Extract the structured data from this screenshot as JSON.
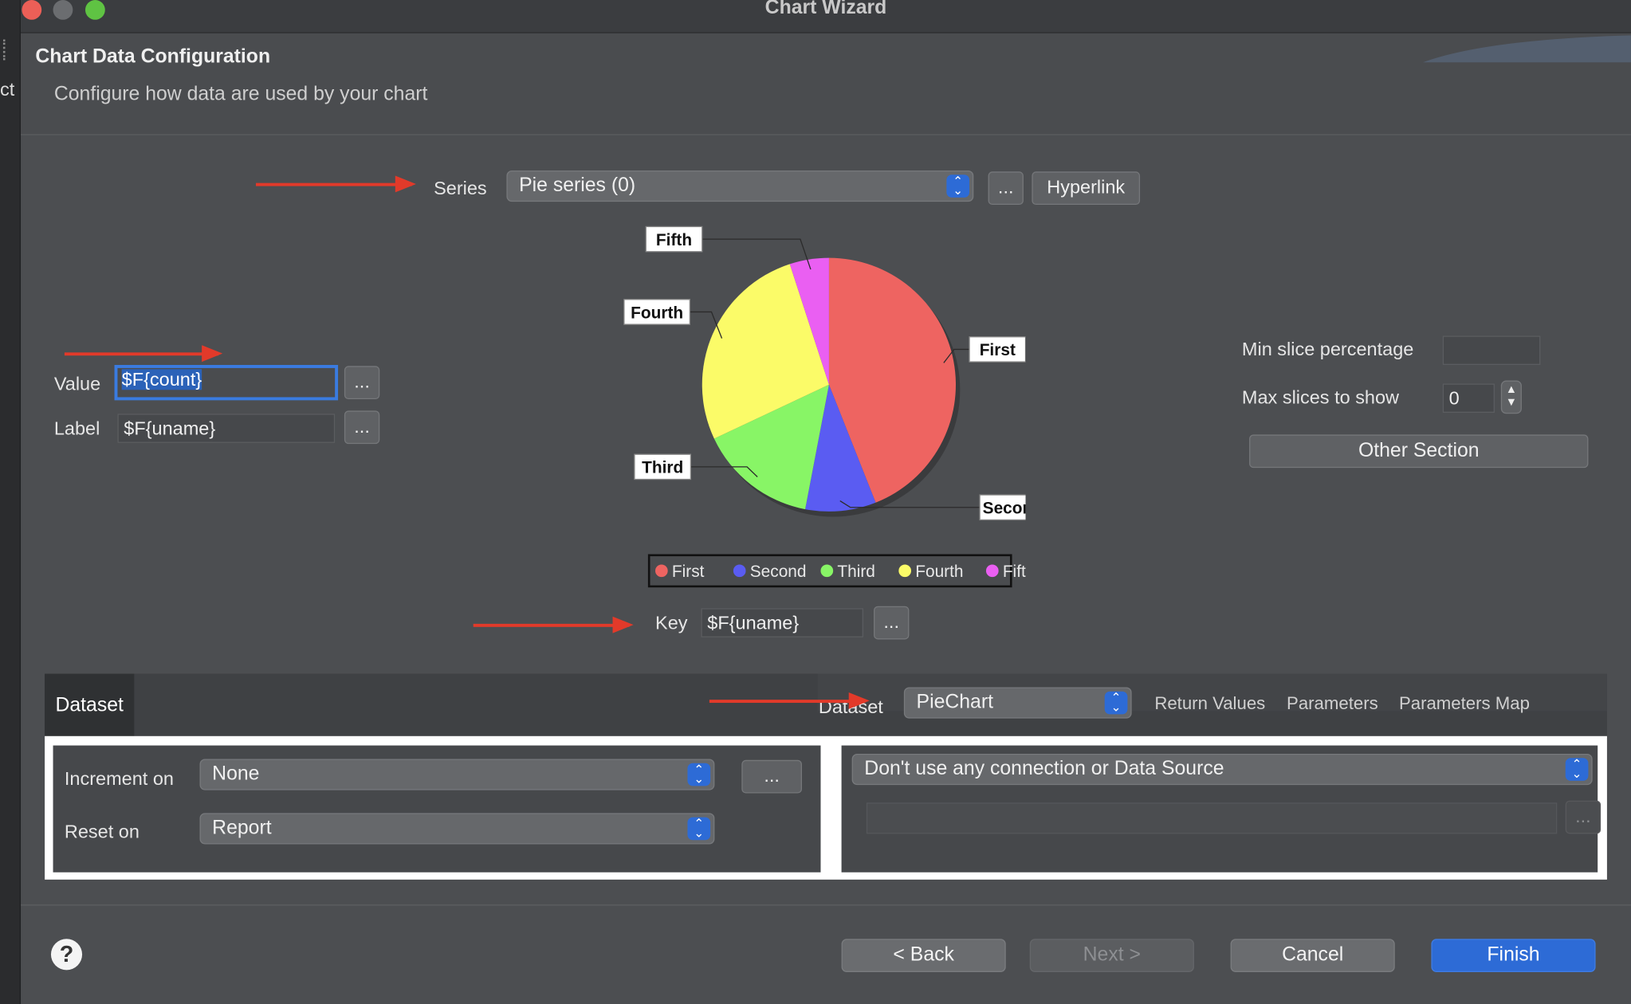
{
  "window": {
    "title": "Chart Wizard"
  },
  "left_strip": {
    "text": "ct"
  },
  "header": {
    "title": "Chart Data Configuration",
    "subtitle": "Configure how data are used by your chart"
  },
  "series": {
    "label": "Series",
    "value": "Pie series (0)",
    "more_label": "...",
    "hyperlink_label": "Hyperlink"
  },
  "value_field": {
    "label": "Value",
    "value": "$F{count}",
    "more_label": "..."
  },
  "label_field": {
    "label": "Label",
    "value": "$F{uname}",
    "more_label": "..."
  },
  "key_field": {
    "label": "Key",
    "value": "$F{uname}",
    "more_label": "..."
  },
  "pie_options": {
    "min_slice_label": "Min slice percentage",
    "min_slice_value": "",
    "max_slices_label": "Max slices to show",
    "max_slices_value": "0",
    "other_section_label": "Other Section"
  },
  "chart_data": {
    "type": "pie",
    "categories": [
      "First",
      "Second",
      "Third",
      "Fourth",
      "Fifth"
    ],
    "values": [
      44,
      9,
      15,
      27,
      5
    ],
    "colors": [
      "#ee6461",
      "#5a5cf2",
      "#88f566",
      "#fbfb68",
      "#ea5ff2"
    ],
    "legend": "bottom"
  },
  "dataset_tab": {
    "tab_label": "Dataset",
    "dataset_label": "Dataset",
    "dataset_value": "PieChart",
    "return_values": "Return Values",
    "parameters": "Parameters",
    "parameters_map": "Parameters Map"
  },
  "increment": {
    "label": "Increment on",
    "value": "None",
    "more_label": "..."
  },
  "reset": {
    "label": "Reset on",
    "value": "Report"
  },
  "connection": {
    "value": "Don't use any connection or Data Source",
    "expression": "",
    "more_label": "..."
  },
  "footer": {
    "help": "?",
    "back": "< Back",
    "next": "Next >",
    "cancel": "Cancel",
    "finish": "Finish"
  },
  "colors": {
    "accent": "#2d6bd6",
    "annotation_arrow": "#e23a2a"
  }
}
